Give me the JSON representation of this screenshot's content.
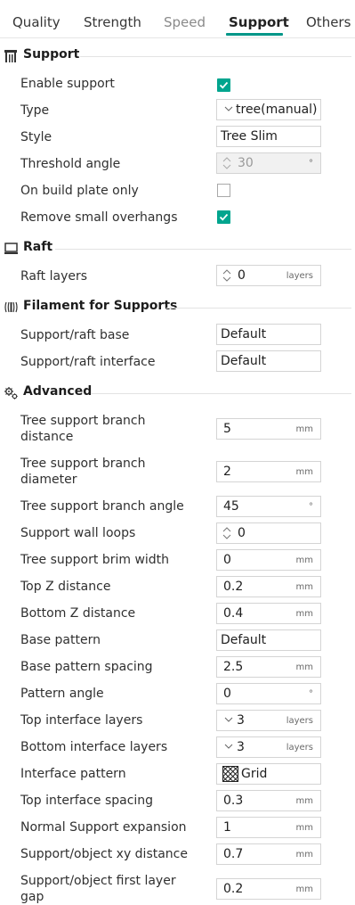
{
  "tabs": [
    "Quality",
    "Strength",
    "Speed",
    "Support",
    "Others"
  ],
  "colors": {
    "accent": "#009688",
    "check": "#00a58e"
  },
  "support": {
    "title": "Support",
    "enable_label": "Enable support",
    "enable_checked": true,
    "type_label": "Type",
    "type_value": "tree(manual)",
    "style_label": "Style",
    "style_value": "Tree Slim",
    "threshold_label": "Threshold angle",
    "threshold_value": "30",
    "threshold_unit": "°",
    "build_plate_label": "On build plate only",
    "build_plate_checked": false,
    "overhangs_label": "Remove small overhangs",
    "overhangs_checked": true
  },
  "raft": {
    "title": "Raft",
    "layers_label": "Raft layers",
    "layers_value": "0",
    "layers_unit": "layers"
  },
  "filament": {
    "title": "Filament for Supports",
    "base_label": "Support/raft base",
    "base_value": "Default",
    "interface_label": "Support/raft interface",
    "interface_value": "Default"
  },
  "advanced": {
    "title": "Advanced",
    "branch_distance_label_1": "Tree support branch",
    "branch_distance_label_2": "distance",
    "branch_distance_value": "5",
    "branch_distance_unit": "mm",
    "branch_diameter_label_1": "Tree support branch",
    "branch_diameter_label_2": "diameter",
    "branch_diameter_value": "2",
    "branch_diameter_unit": "mm",
    "branch_angle_label": "Tree support branch angle",
    "branch_angle_value": "45",
    "branch_angle_unit": "°",
    "wall_loops_label": "Support wall loops",
    "wall_loops_value": "0",
    "brim_width_label": "Tree support brim width",
    "brim_width_value": "0",
    "brim_width_unit": "mm",
    "top_z_label": "Top Z distance",
    "top_z_value": "0.2",
    "top_z_unit": "mm",
    "bottom_z_label": "Bottom Z distance",
    "bottom_z_value": "0.4",
    "bottom_z_unit": "mm",
    "base_pattern_label": "Base pattern",
    "base_pattern_value": "Default",
    "base_spacing_label": "Base pattern spacing",
    "base_spacing_value": "2.5",
    "base_spacing_unit": "mm",
    "pattern_angle_label": "Pattern angle",
    "pattern_angle_value": "0",
    "pattern_angle_unit": "°",
    "top_interface_label": "Top interface layers",
    "top_interface_value": "3",
    "top_interface_unit": "layers",
    "bottom_interface_label": "Bottom interface layers",
    "bottom_interface_value": "3",
    "bottom_interface_unit": "layers",
    "interface_pattern_label": "Interface pattern",
    "interface_pattern_value": "Grid",
    "top_spacing_label": "Top interface spacing",
    "top_spacing_value": "0.3",
    "top_spacing_unit": "mm",
    "normal_expansion_label": "Normal Support expansion",
    "normal_expansion_value": "1",
    "normal_expansion_unit": "mm",
    "xy_distance_label": "Support/object xy distance",
    "xy_distance_value": "0.7",
    "xy_distance_unit": "mm",
    "first_layer_gap_label_1": "Support/object first layer",
    "first_layer_gap_label_2": "gap",
    "first_layer_gap_value": "0.2",
    "first_layer_gap_unit": "mm"
  }
}
